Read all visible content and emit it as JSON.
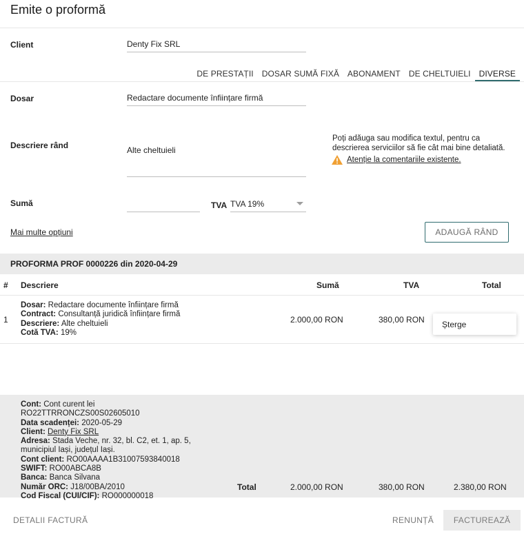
{
  "page": {
    "title": "Emite o proformă"
  },
  "form": {
    "client_label": "Client",
    "client_value": "Denty Fix SRL",
    "tabs": [
      {
        "label": "DE PRESTAȚII"
      },
      {
        "label": "DOSAR SUMĂ FIXĂ"
      },
      {
        "label": "ABONAMENT"
      },
      {
        "label": "DE CHELTUIELI"
      },
      {
        "label": "DIVERSE"
      }
    ],
    "active_tab": "DIVERSE",
    "dosar_label": "Dosar",
    "dosar_value": "Redactare documente înființare firmă",
    "descriere_label": "Descriere rând",
    "descriere_value": "Alte cheltuieli",
    "hint_text": "Poți adăuga sau modifica textul, pentru ca descrierea serviciilor să fie cât mai bine detaliată.",
    "warning_link": "Atenție la comentariile existente.",
    "suma_label": "Sumă",
    "suma_value": "",
    "tva_label": "TVA",
    "tva_value": "TVA 19%",
    "more_options": "Mai multe opțiuni",
    "add_row_button": "ADAUGĂ RÂND"
  },
  "proforma": {
    "header": "PROFORMA PROF 0000226 din 2020-04-29",
    "columns": [
      "#",
      "Descriere",
      "Sumă",
      "TVA",
      "Total"
    ],
    "rows": [
      {
        "index": "1",
        "dosar_label": "Dosar:",
        "dosar": "Redactare documente înființare firmă",
        "contract_label": "Contract:",
        "contract": "Consultanță juridică înființare firmă",
        "descriere_label": "Descriere:",
        "descriere": "Alte cheltuieli",
        "cota_label": "Cotă TVA:",
        "cota": "19%",
        "suma": "2.000,00 RON",
        "tva": "380,00 RON"
      }
    ],
    "row_menu": {
      "delete": "Șterge"
    }
  },
  "footer": {
    "cont_label": "Cont:",
    "cont": "Cont curent lei RO22TTRRONCZS00S02605010",
    "scadenta_label": "Data scadenței:",
    "scadenta": "2020-05-29",
    "client_label": "Client:",
    "client": "Denty Fix SRL",
    "adresa_label": "Adresa:",
    "adresa": "Stada Veche, nr. 32, bl. C2, et. 1, ap. 5, municipiul Iași, județul Iași.",
    "cont_client_label": "Cont client:",
    "cont_client": "RO00AAAA1B31007593840018",
    "swift_label": "SWIFT:",
    "swift": "RO00ABCA8B",
    "banca_label": "Banca:",
    "banca": "Banca Silvana",
    "orc_label": "Număr ORC:",
    "orc": "J18/00BA/2010",
    "cif_label": "Cod Fiscal (CUI/CIF):",
    "cif": "RO000000018",
    "total_label": "Total",
    "total_suma": "2.000,00 RON",
    "total_tva": "380,00 RON",
    "total": "2.380,00 RON"
  },
  "actions": {
    "details": "DETALII FACTURĂ",
    "cancel": "RENUNȚĂ",
    "invoice": "FACTUREAZĂ"
  },
  "colors": {
    "accent": "#2f6b6e",
    "warning": "#f0a033",
    "band": "#ebebeb"
  }
}
